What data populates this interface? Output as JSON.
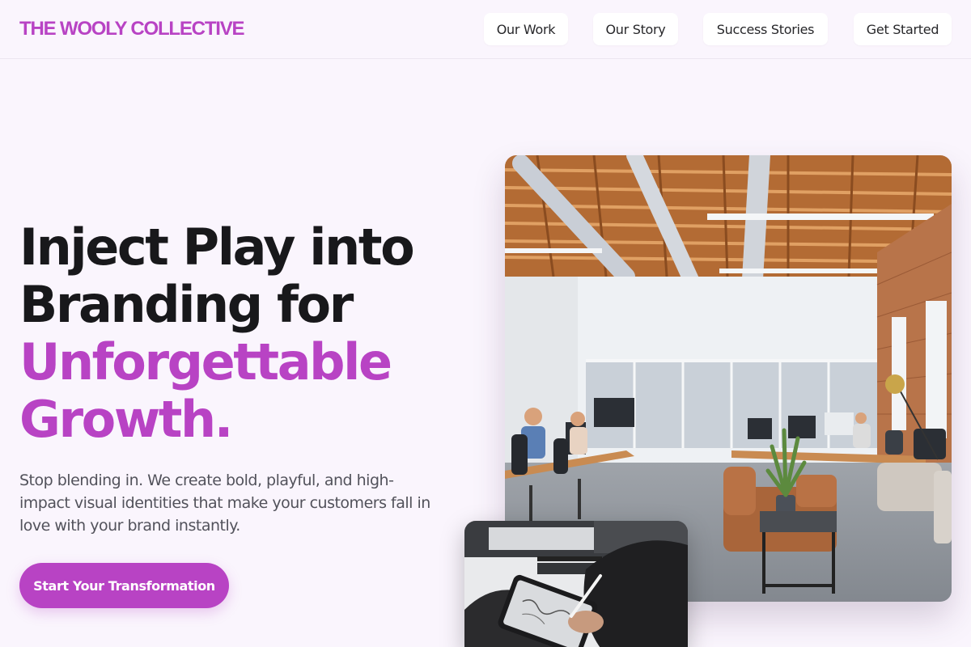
{
  "brand": {
    "name": "THE WOOLY COLLECTIVE",
    "accent": "#b843c4"
  },
  "nav": {
    "items": [
      {
        "label": "Our Work"
      },
      {
        "label": "Our Story"
      },
      {
        "label": "Success Stories"
      },
      {
        "label": "Get Started"
      }
    ]
  },
  "hero": {
    "headline_line1": "Inject Play into",
    "headline_line2": "Branding for",
    "headline_accent1": "Unforgettable",
    "headline_accent2": "Growth.",
    "subtext": "Stop blending in. We create bold, playful, and high-impact visual identities that make your customers fall in love with your brand instantly.",
    "cta_label": "Start Your Transformation"
  },
  "images": {
    "office_photo": "office-interior-photo",
    "tablet_photo": "tablet-sketching-photo"
  }
}
